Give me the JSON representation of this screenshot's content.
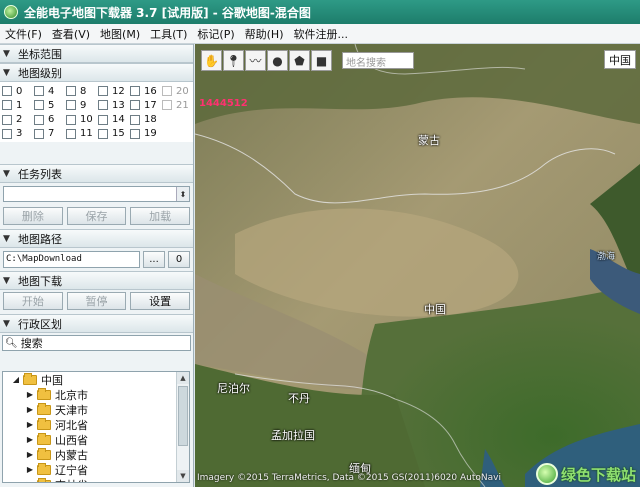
{
  "window": {
    "title": "全能电子地图下载器 3.7 [试用版] - 谷歌地图-混合图"
  },
  "menu": [
    "文件(F)",
    "查看(V)",
    "地图(M)",
    "工具(T)",
    "标记(P)",
    "帮助(H)",
    "软件注册..."
  ],
  "sections": {
    "coords": "坐标范围",
    "levels": "地图级别",
    "tasks": "任务列表",
    "path": "地图路径",
    "download": "地图下载",
    "admin": "行政区划"
  },
  "levels": [
    {
      "label": "0",
      "enabled": true
    },
    {
      "label": "4",
      "enabled": true
    },
    {
      "label": "8",
      "enabled": true
    },
    {
      "label": "12",
      "enabled": true
    },
    {
      "label": "16",
      "enabled": true
    },
    {
      "label": "20",
      "enabled": false
    },
    {
      "label": "1",
      "enabled": true
    },
    {
      "label": "5",
      "enabled": true
    },
    {
      "label": "9",
      "enabled": true
    },
    {
      "label": "13",
      "enabled": true
    },
    {
      "label": "17",
      "enabled": true
    },
    {
      "label": "21",
      "enabled": false
    },
    {
      "label": "2",
      "enabled": true
    },
    {
      "label": "6",
      "enabled": true
    },
    {
      "label": "10",
      "enabled": true
    },
    {
      "label": "14",
      "enabled": true
    },
    {
      "label": "18",
      "enabled": true
    },
    {
      "label": "",
      "enabled": false
    },
    {
      "label": "3",
      "enabled": true
    },
    {
      "label": "7",
      "enabled": true
    },
    {
      "label": "11",
      "enabled": true
    },
    {
      "label": "15",
      "enabled": true
    },
    {
      "label": "19",
      "enabled": true
    },
    {
      "label": "",
      "enabled": false
    }
  ],
  "tasks": {
    "delete": "删除",
    "save": "保存",
    "load": "加载"
  },
  "path": {
    "value": "C:\\MapDownload",
    "browse": "...",
    "open": "0"
  },
  "download": {
    "start": "开始",
    "pause": "暂停",
    "settings": "设置"
  },
  "admin": {
    "search_placeholder": "搜索",
    "tree": [
      {
        "label": "中国",
        "expanded": true,
        "level": 0
      },
      {
        "label": "北京市",
        "level": 1
      },
      {
        "label": "天津市",
        "level": 1
      },
      {
        "label": "河北省",
        "level": 1
      },
      {
        "label": "山西省",
        "level": 1
      },
      {
        "label": "内蒙古",
        "level": 1
      },
      {
        "label": "辽宁省",
        "level": 1
      },
      {
        "label": "吉林省",
        "level": 1
      }
    ]
  },
  "map": {
    "search_placeholder": "地名搜索",
    "type_button": "中国",
    "coord_readout": "1444512",
    "labels": {
      "mongolia": "蒙古",
      "china": "中国",
      "nepal": "尼泊尔",
      "bhutan": "不丹",
      "bangladesh": "孟加拉国",
      "myanmar": "缅甸",
      "bohai": "渤海"
    },
    "copyright": "Imagery ©2015 TerraMetrics, Data ©2015 GS(2011)6020 AutoNavi",
    "watermark": "绿色下载站"
  },
  "colors": {
    "titlebar": "#1d7d6b",
    "accent": "#ff3070"
  }
}
